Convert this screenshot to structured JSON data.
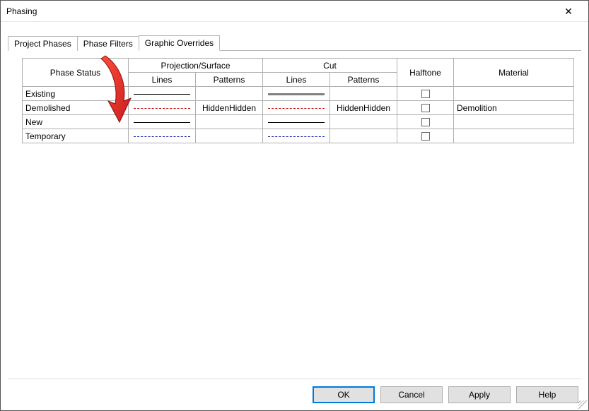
{
  "window": {
    "title": "Phasing"
  },
  "tabs": {
    "project_phases": "Project Phases",
    "phase_filters": "Phase Filters",
    "graphic_overrides": "Graphic Overrides",
    "active": "graphic_overrides"
  },
  "headers": {
    "phase_status": "Phase Status",
    "projection_surface": "Projection/Surface",
    "cut": "Cut",
    "halftone": "Halftone",
    "material": "Material",
    "lines": "Lines",
    "patterns": "Patterns"
  },
  "rows": [
    {
      "status": "Existing",
      "proj_lines": {
        "style": "solid-black"
      },
      "proj_patterns": "",
      "cut_lines": {
        "style": "solid-thick"
      },
      "cut_patterns": "",
      "halftone": false,
      "material": ""
    },
    {
      "status": "Demolished",
      "proj_lines": {
        "style": "dash-red"
      },
      "proj_patterns": "HiddenHidden",
      "cut_lines": {
        "style": "dash-red"
      },
      "cut_patterns": "HiddenHidden",
      "halftone": false,
      "material": "Demolition"
    },
    {
      "status": "New",
      "proj_lines": {
        "style": "solid-black"
      },
      "proj_patterns": "",
      "cut_lines": {
        "style": "solid-black"
      },
      "cut_patterns": "",
      "halftone": false,
      "material": ""
    },
    {
      "status": "Temporary",
      "proj_lines": {
        "style": "dash-blue"
      },
      "proj_patterns": "",
      "cut_lines": {
        "style": "dash-blue"
      },
      "cut_patterns": "",
      "halftone": false,
      "material": ""
    }
  ],
  "buttons": {
    "ok": "OK",
    "cancel": "Cancel",
    "apply": "Apply",
    "help": "Help"
  },
  "annotation": {
    "arrow_points_to": "Demolished Projection/Surface Lines cell"
  }
}
